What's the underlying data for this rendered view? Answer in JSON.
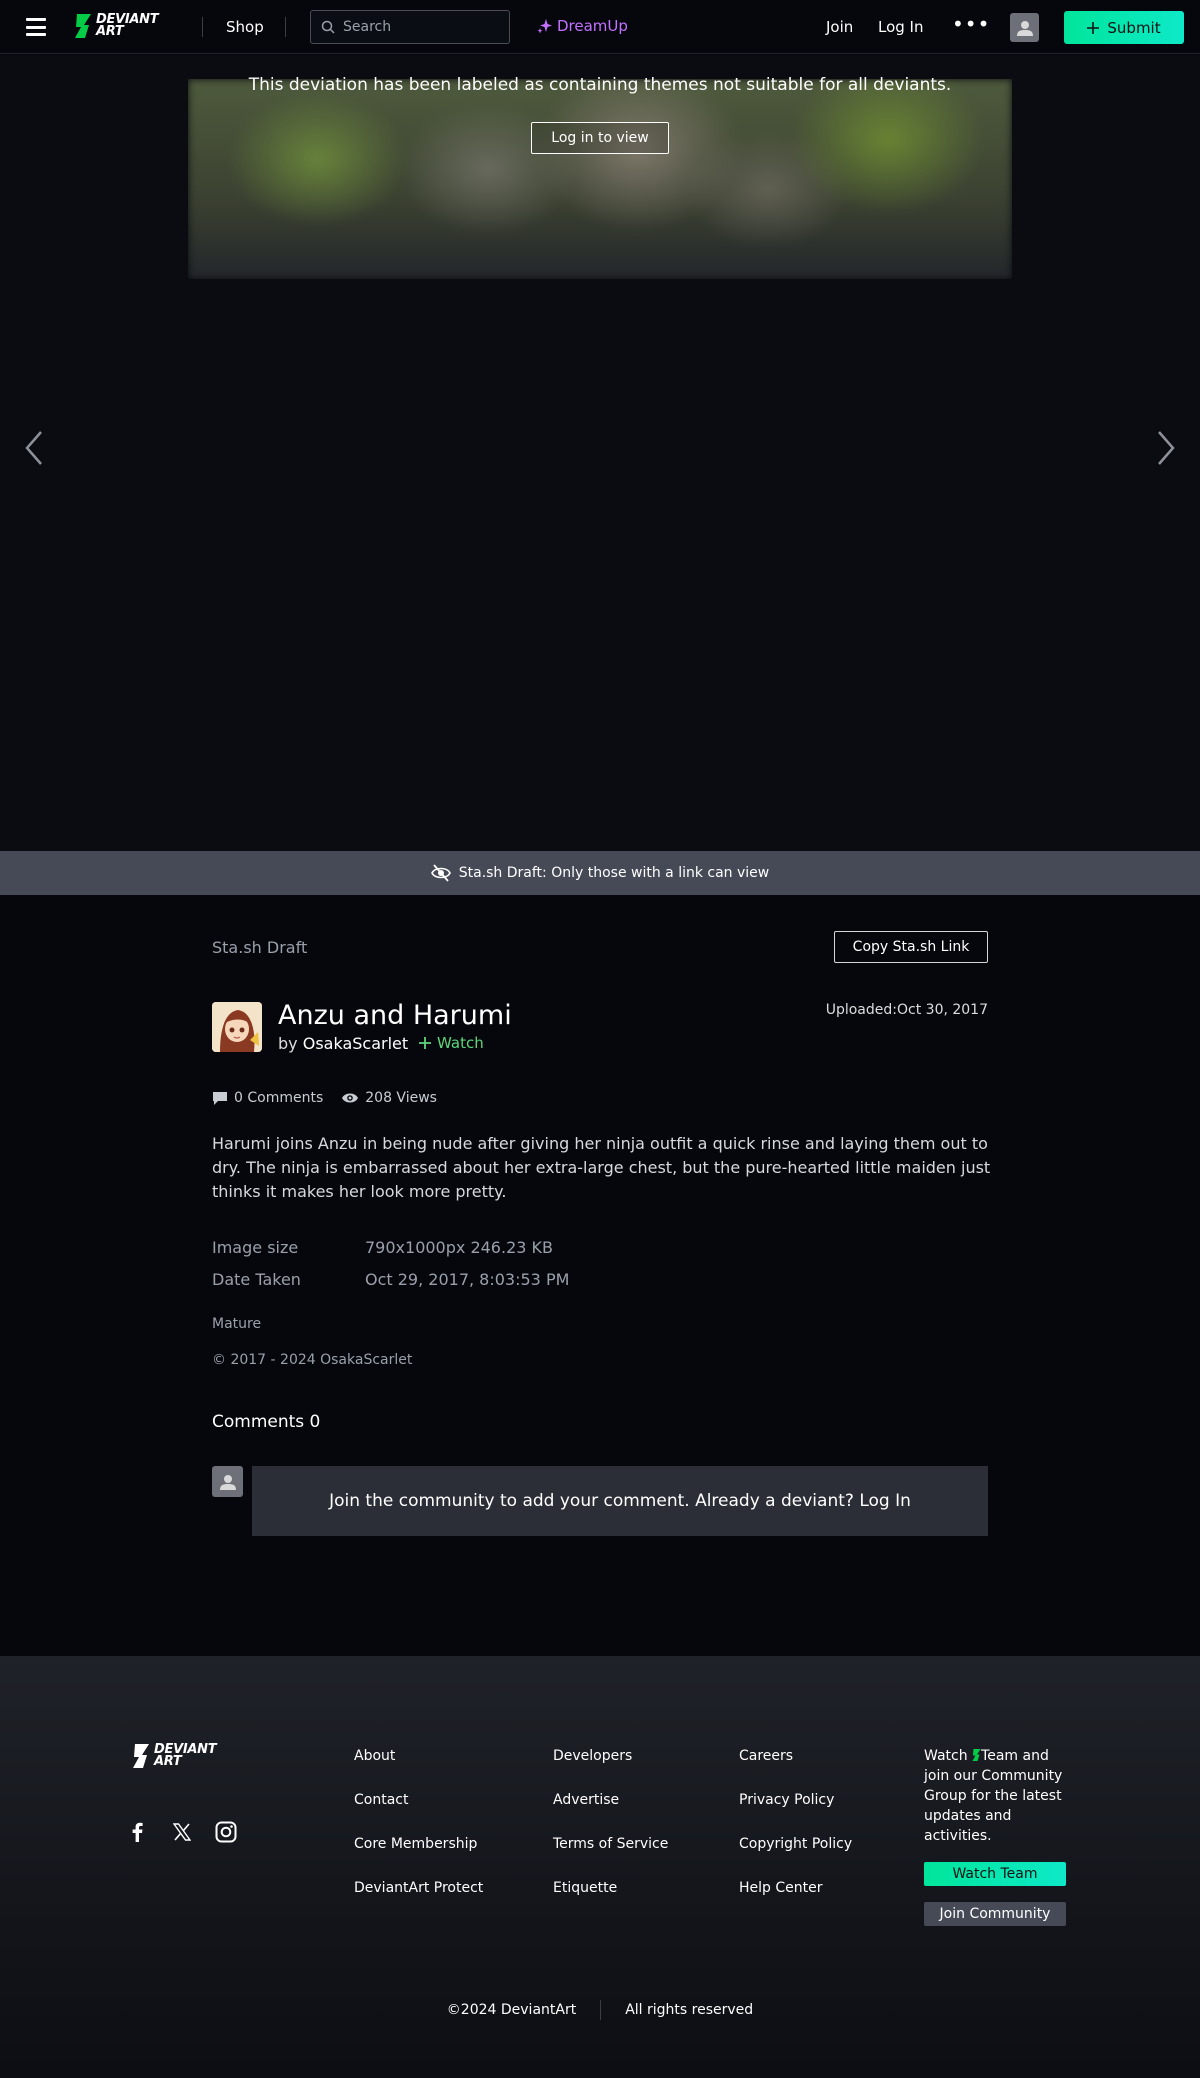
{
  "nav": {
    "logo_line1": "DEVIANT",
    "logo_line2": "ART",
    "shop": "Shop",
    "search_placeholder": "Search",
    "dreamup": "DreamUp",
    "join": "Join",
    "login": "Log In",
    "more": "•••",
    "submit": "Submit"
  },
  "hero": {
    "mature_message": "This deviation has been labeled as containing themes not suitable for all deviants.",
    "login_to_view": "Log in to view"
  },
  "draft_banner": "Sta.sh Draft: Only those with a link can view",
  "details": {
    "section_label": "Sta.sh Draft",
    "copy_link": "Copy Sta.sh Link",
    "title": "Anzu and Harumi",
    "by": "by",
    "author": "OsakaScarlet",
    "watch": "Watch",
    "uploaded_label": "Uploaded:",
    "uploaded_date": "Oct 30, 2017",
    "comments_count": "0 Comments",
    "views_count": "208 Views",
    "description": "Harumi joins Anzu in being nude after giving her ninja outfit a quick rinse and laying them out to dry. The ninja is embarrassed about her extra-large chest, but the pure-hearted little maiden just thinks it makes her look more pretty.",
    "image_size_label": "Image size",
    "image_size_value": "790x1000px 246.23 KB",
    "date_taken_label": "Date Taken",
    "date_taken_value": "Oct 29, 2017, 8:03:53 PM",
    "mature_tag": "Mature",
    "copyright": "© 2017 - 2024 OsakaScarlet"
  },
  "comments": {
    "title": "Comments 0",
    "prompt": "Join the community to add your comment. Already a deviant?",
    "login": "Log In"
  },
  "footer": {
    "col1": [
      "About",
      "Contact",
      "Core Membership",
      "DeviantArt Protect"
    ],
    "col2": [
      "Developers",
      "Advertise",
      "Terms of Service",
      "Etiquette"
    ],
    "col3": [
      "Careers",
      "Privacy Policy",
      "Copyright Policy",
      "Help Center"
    ],
    "watch_text_prefix": "Watch",
    "watch_text_suffix": "Team and join our Community Group for the latest updates and activities.",
    "watch_team": "Watch Team",
    "join_community": "Join Community",
    "copyright": "©2024 DeviantArt",
    "rights": "All rights reserved"
  },
  "colors": {
    "brand_green": "#00e59b",
    "dreamup_purple": "#c372ff",
    "watch_green": "#5cd67a",
    "banner_gray": "#464a57"
  }
}
